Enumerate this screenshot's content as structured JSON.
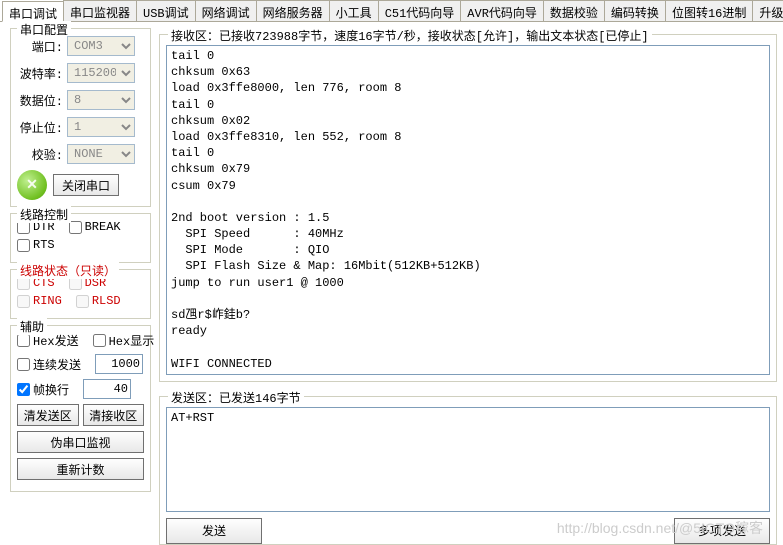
{
  "tabs": [
    "串口调试",
    "串口监视器",
    "USB调试",
    "网络调试",
    "网络服务器",
    "小工具",
    "C51代码向导",
    "AVR代码向导",
    "数据校验",
    "编码转换",
    "位图转16进制",
    "升级与配"
  ],
  "active_tab_index": 0,
  "serial_config": {
    "legend": "串口配置",
    "port_label": "端口:",
    "port_value": "COM3",
    "baud_label": "波特率:",
    "baud_value": "115200",
    "data_label": "数据位:",
    "data_value": "8",
    "stop_label": "停止位:",
    "stop_value": "1",
    "parity_label": "校验:",
    "parity_value": "NONE",
    "close_button": "关闭串口"
  },
  "line_control": {
    "legend": "线路控制",
    "dtr": "DTR",
    "break": "BREAK",
    "rts": "RTS"
  },
  "line_status": {
    "legend": "线路状态（只读）",
    "cts": "CTS",
    "dsr": "DSR",
    "ring": "RING",
    "rlsd": "RLSD"
  },
  "aux": {
    "legend": "辅助",
    "hex_send": "Hex发送",
    "hex_show": "Hex显示",
    "cont_send": "连续发送",
    "cont_val": "1000",
    "wrap": "帧换行",
    "wrap_val": "40",
    "clear_send": "清发送区",
    "clear_recv": "清接收区",
    "fake_monitor": "伪串口监视",
    "reset_count": "重新计数"
  },
  "recv": {
    "legend": "接收区：已接收723988字节，速度16字节/秒，接收状态[允许]，输出文本状态[已停止]",
    "text": "tail 0\nchksum 0x63\nload 0x3ffe8000, len 776, room 8\ntail 0\nchksum 0x02\nload 0x3ffe8310, len 552, room 8\ntail 0\nchksum 0x79\ncsum 0x79\n\n2nd boot version : 1.5\n  SPI Speed      : 40MHz\n  SPI Mode       : QIO\n  SPI Flash Size & Map: 16Mbit(512KB+512KB)\njump to run user1 @ 1000\n\nsd乪r$岞銈b?\nready\n\nWIFI CONNECTED"
  },
  "send": {
    "legend": "发送区：已发送146字节",
    "text": "AT+RST",
    "send_button": "发送",
    "multi_send_button": "多项发送"
  },
  "watermark": "http://blog.csdn.net/@5IOTO稼客"
}
